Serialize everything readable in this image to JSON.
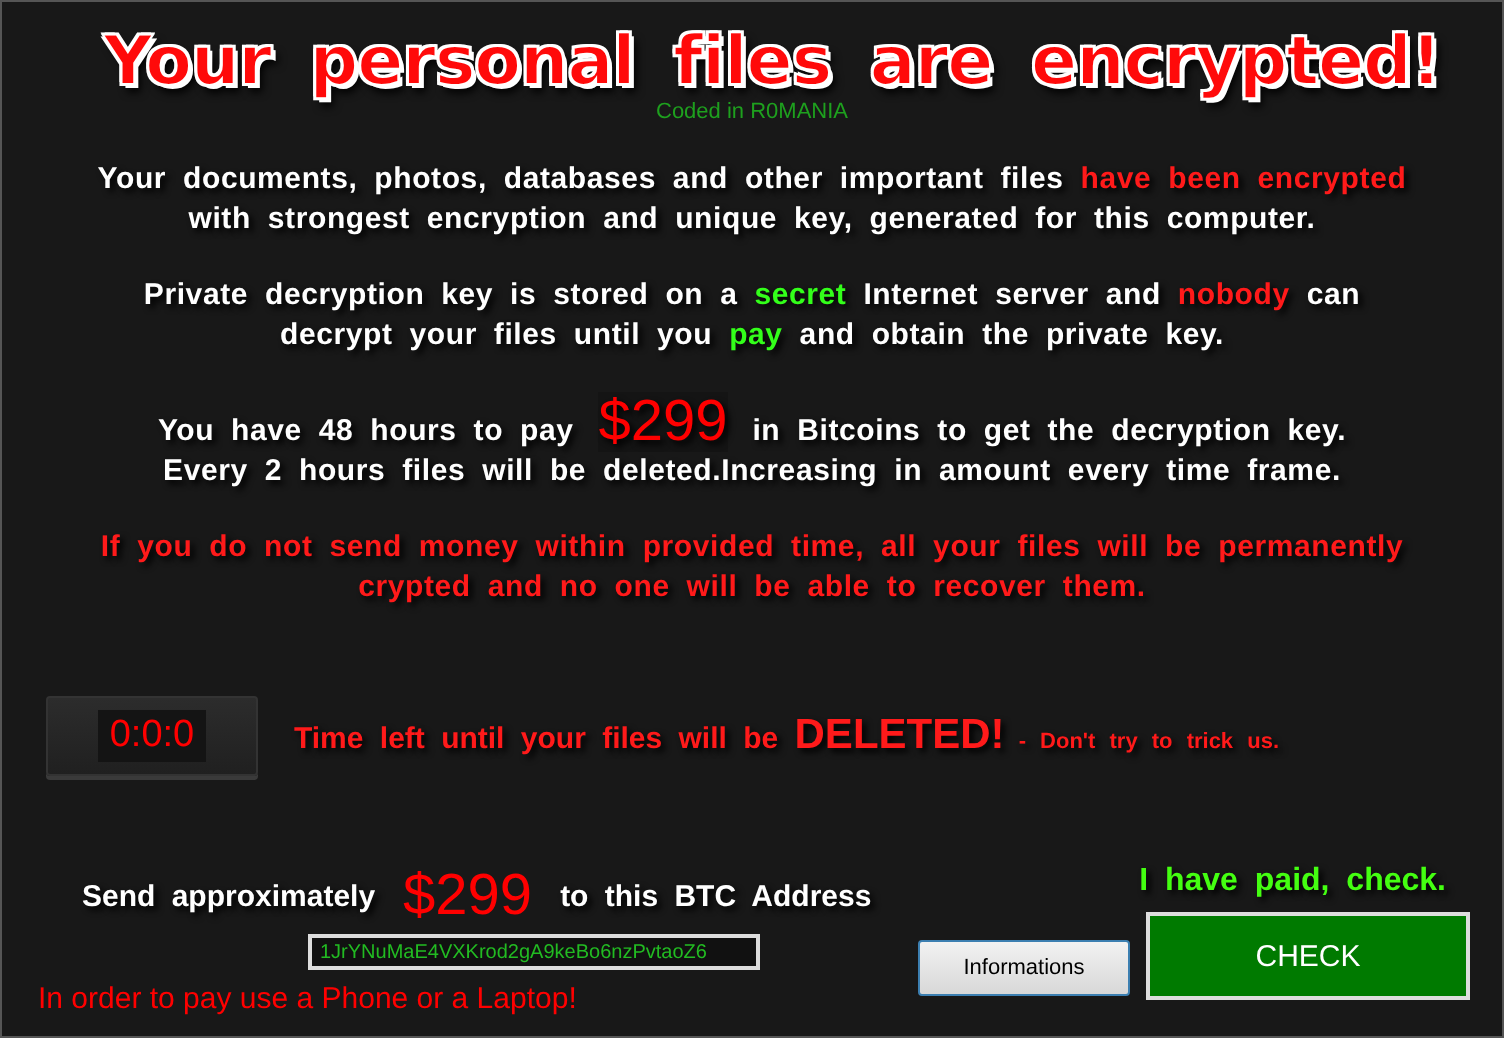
{
  "title": "Your personal files are encrypted!",
  "credit": "Coded in R0MANIA",
  "paragraphs": [
    {
      "lines": [
        [
          {
            "kind": "plain",
            "text": "Your documents, photos, databases and other important files "
          },
          {
            "kind": "alert",
            "text": "have been encrypted"
          }
        ],
        [
          {
            "kind": "plain",
            "text": "with strongest encryption and unique key, generated for this computer."
          }
        ]
      ]
    },
    {
      "lines": [
        [
          {
            "kind": "plain",
            "text": "Private decryption key is stored on a "
          },
          {
            "kind": "highlight",
            "text": "secret"
          },
          {
            "kind": "plain",
            "text": " Internet server and "
          },
          {
            "kind": "alert",
            "text": "nobody"
          },
          {
            "kind": "plain",
            "text": " can"
          }
        ],
        [
          {
            "kind": "plain",
            "text": "decrypt your files until you "
          },
          {
            "kind": "highlight",
            "text": "pay"
          },
          {
            "kind": "plain",
            "text": " and obtain the private key."
          }
        ]
      ]
    },
    {
      "lines": [
        [
          {
            "kind": "plain",
            "text": "You have 48 hours to pay "
          },
          {
            "kind": "amount",
            "text": "$299"
          },
          {
            "kind": "plain",
            "text": " in Bitcoins to get the decryption key."
          }
        ],
        [
          {
            "kind": "plain",
            "text": "Every 2 hours files will be deleted.Increasing in amount every time frame."
          }
        ]
      ]
    },
    {
      "lines": [
        [
          {
            "kind": "alert",
            "text": "If you do not send money within provided time, all your files will be permanently"
          }
        ],
        [
          {
            "kind": "alert",
            "text": "crypted and no one will be able to recover them."
          }
        ]
      ]
    }
  ],
  "timer": {
    "value": "0:0:0",
    "message": "Time left until your files will be ",
    "emphasis": "DELETED!",
    "note": " - Don't try to trick us."
  },
  "payment": {
    "send": "Send approximately",
    "amount": "$299",
    "target": "to this BTC Address",
    "address": "1JrYNuMaE4VXKrod2gA9keBo6nzPvtaoZ6",
    "hint": "In order to pay use a Phone or a Laptop!",
    "paid": "I have paid, check."
  },
  "buttons": {
    "info": "Informations",
    "check": "CHECK"
  }
}
